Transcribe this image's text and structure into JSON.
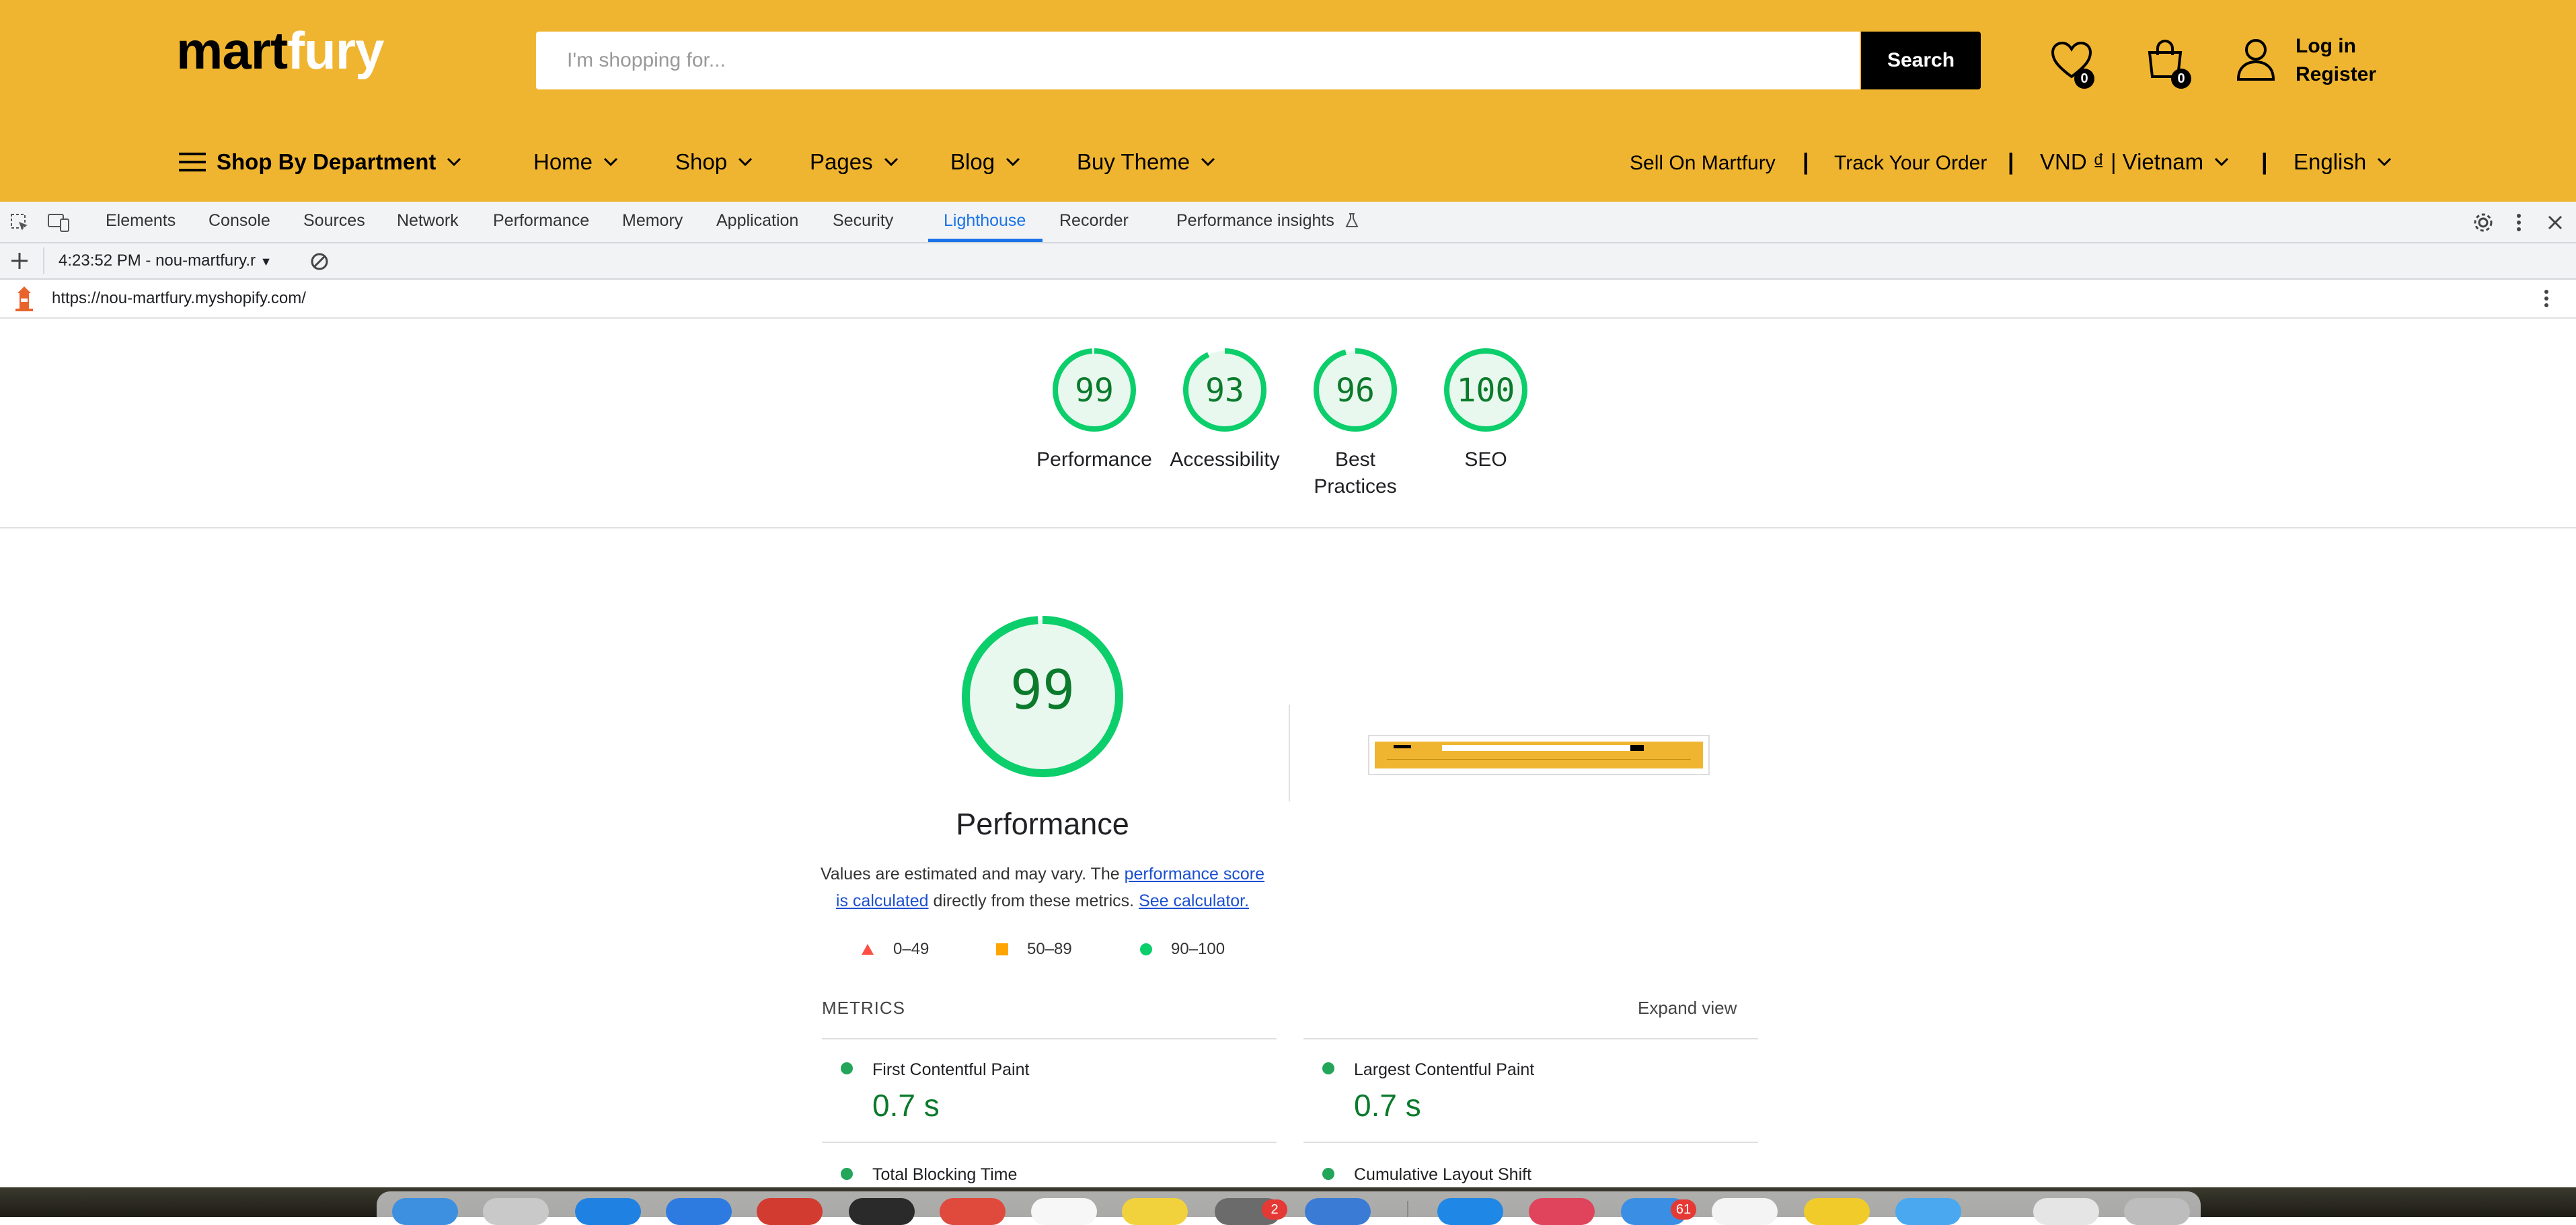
{
  "site": {
    "logo_primary": "mart",
    "logo_secondary": "fury",
    "search_placeholder": "I'm shopping for...",
    "search_button": "Search",
    "wishlist_count": "0",
    "cart_count": "0",
    "login": "Log in",
    "register": "Register",
    "nav": {
      "department": "Shop By Department",
      "items": [
        "Home",
        "Shop",
        "Pages",
        "Blog",
        "Buy Theme"
      ],
      "sell": "Sell On Martfury",
      "track": "Track Your Order",
      "currency": "VND ₫ | Vietnam",
      "language": "English",
      "separator": "|"
    },
    "colors": {
      "header_bg": "#f0b530"
    }
  },
  "devtools": {
    "tabs": [
      "Elements",
      "Console",
      "Sources",
      "Network",
      "Performance",
      "Memory",
      "Application",
      "Security",
      "Lighthouse",
      "Recorder",
      "Performance insights"
    ],
    "active_tab": "Lighthouse",
    "report_selector": "4:23:52 PM - nou-martfury.r",
    "url": "https://nou-martfury.myshopify.com/",
    "icons": [
      "inspect-icon",
      "device-toggle-icon",
      "settings-gear-icon",
      "more-vert-icon",
      "close-icon",
      "plus-icon",
      "clear-icon",
      "lighthouse-icon",
      "flask-icon"
    ]
  },
  "lighthouse": {
    "categories": [
      {
        "label": "Performance",
        "score": "99",
        "fraction": 0.99
      },
      {
        "label": "Accessibility",
        "score": "93",
        "fraction": 0.93
      },
      {
        "label": "Best Practices",
        "score": "96",
        "fraction": 0.96
      },
      {
        "label": "SEO",
        "score": "100",
        "fraction": 1.0
      }
    ],
    "best_practices_line1": "Best",
    "best_practices_line2": "Practices",
    "main_score": "99",
    "main_title": "Performance",
    "desc_1": "Values are estimated and may vary. The ",
    "desc_link_1": "performance score is calculated",
    "desc_2": " directly from these metrics. ",
    "desc_link_2": "See calculator.",
    "legend": {
      "fail": "0–49",
      "average": "50–89",
      "pass": "90–100"
    },
    "metrics_heading": "METRICS",
    "expand_view": "Expand view",
    "metrics": [
      {
        "name": "First Contentful Paint",
        "value": "0.7 s"
      },
      {
        "name": "Largest Contentful Paint",
        "value": "0.7 s"
      },
      {
        "name": "Total Blocking Time",
        "value": ""
      },
      {
        "name": "Cumulative Layout Shift",
        "value": ""
      }
    ],
    "colors": {
      "pass": "#0cce6b",
      "pass_text": "#0b7a2c",
      "average": "#ffa400",
      "fail": "#ff4e42"
    }
  },
  "dock": {
    "badges": [
      "2",
      "61"
    ]
  }
}
